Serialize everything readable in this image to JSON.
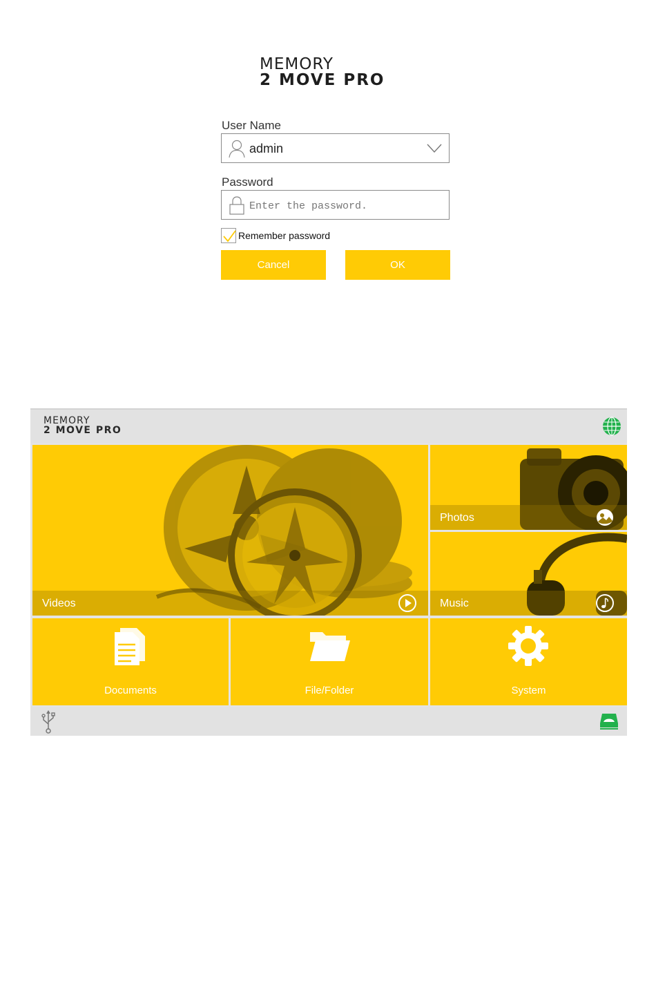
{
  "login": {
    "logo": {
      "line1": "MEMORY",
      "line2": "2 MOVE PRO"
    },
    "username": {
      "label": "User Name",
      "value": "admin",
      "icon": "user-icon"
    },
    "password": {
      "label": "Password",
      "placeholder": "Enter the password.",
      "icon": "lock-icon"
    },
    "remember": {
      "label": "Remember password",
      "checked": true
    },
    "buttons": {
      "cancel": "Cancel",
      "ok": "OK"
    },
    "accent_color": "#ffcb05"
  },
  "dashboard": {
    "logo": {
      "line1": "MEMORY",
      "line2": "2 MOVE PRO"
    },
    "header_icon": "globe-icon",
    "tiles": {
      "videos": {
        "label": "Videos",
        "icon": "play-icon"
      },
      "photos": {
        "label": "Photos",
        "icon": "photo-icon"
      },
      "music": {
        "label": "Music",
        "icon": "music-note-icon"
      },
      "documents": {
        "label": "Documents",
        "icon": "documents-icon"
      },
      "folder": {
        "label": "File/Folder",
        "icon": "folder-icon"
      },
      "system": {
        "label": "System",
        "icon": "gear-icon"
      }
    },
    "footer_icons": [
      "usb-icon",
      "drive-icon"
    ],
    "status_color": "#22b14c"
  }
}
